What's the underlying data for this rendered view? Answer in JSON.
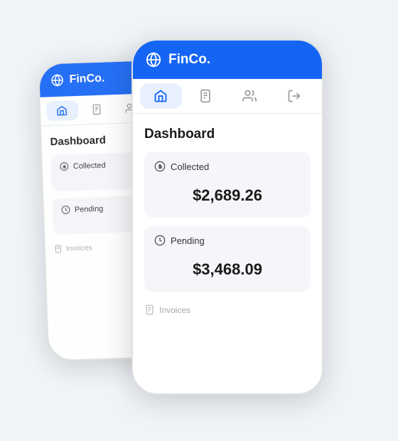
{
  "app": {
    "brand": "FinCo.",
    "page_title": "Dashboard"
  },
  "nav": {
    "items": [
      {
        "id": "home",
        "label": "Home",
        "active": true
      },
      {
        "id": "documents",
        "label": "Documents",
        "active": false
      },
      {
        "id": "users",
        "label": "Users",
        "active": false
      },
      {
        "id": "logout",
        "label": "Logout",
        "active": false
      }
    ]
  },
  "cards": {
    "collected": {
      "label": "Collected",
      "value": "$2,689.26"
    },
    "pending": {
      "label": "Pending",
      "value": "$3,468.09"
    }
  },
  "invoices": {
    "label": "Invoices"
  },
  "colors": {
    "brand_blue": "#1565f5",
    "nav_active_bg": "#e8f0fe",
    "card_bg": "#f5f6fa"
  }
}
